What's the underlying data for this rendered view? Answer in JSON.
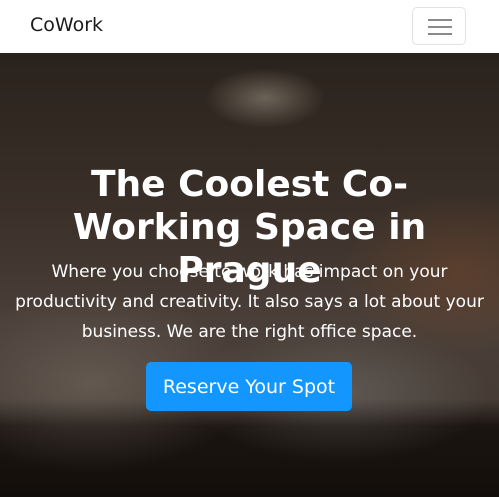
{
  "navbar": {
    "brand": "CoWork",
    "toggler_icon": "hamburger-menu-icon"
  },
  "hero": {
    "title": "The Coolest Co-Working Space in Prague",
    "lead": "Where you choose to work has impact on your productivity and creativity. It also says a lot about your business. We are the right office space.",
    "cta_label": "Reserve Your Spot"
  },
  "colors": {
    "accent": "#1496ff"
  }
}
